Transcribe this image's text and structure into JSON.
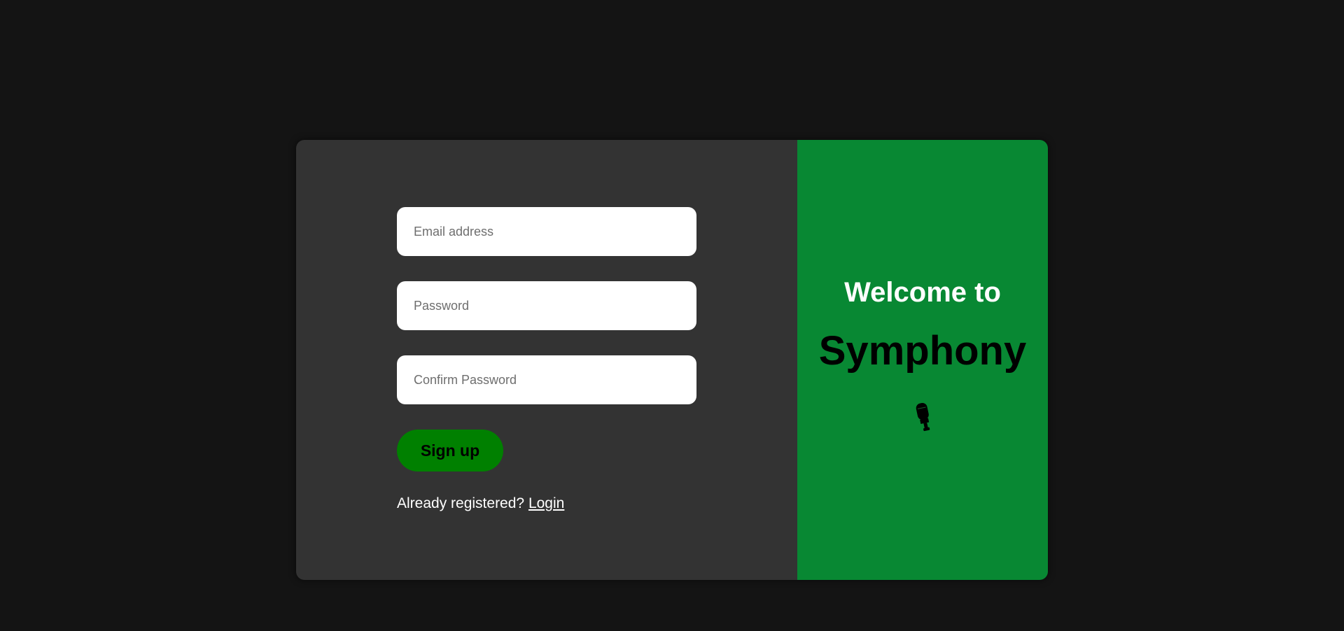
{
  "form": {
    "email": {
      "value": "",
      "placeholder": "Email address"
    },
    "password": {
      "value": "",
      "placeholder": "Password"
    },
    "confirm_password": {
      "value": "",
      "placeholder": "Confirm Password"
    },
    "signup_label": "Sign up",
    "login_prompt": "Already registered?",
    "login_link": "Login"
  },
  "brand": {
    "welcome_text": "Welcome to",
    "app_name": "Symphony",
    "icon": "microphone-icon"
  },
  "colors": {
    "page_background": "#141414",
    "form_panel": "#333333",
    "brand_panel": "#088833",
    "signup_button": "#008000"
  }
}
